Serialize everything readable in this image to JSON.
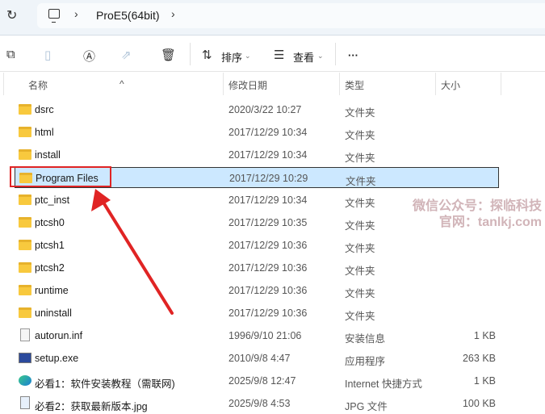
{
  "address": {
    "crumbs": [
      "ProE5(64bit)"
    ]
  },
  "toolbar": {
    "sort_label": "排序",
    "view_label": "查看",
    "more_label": "···"
  },
  "columns": {
    "name": "名称",
    "date": "修改日期",
    "type": "类型",
    "size": "大小"
  },
  "rows": [
    {
      "name": "dsrc",
      "date": "2020/3/22 10:27",
      "type": "文件夹",
      "size": "",
      "icon": "folder"
    },
    {
      "name": "html",
      "date": "2017/12/29 10:34",
      "type": "文件夹",
      "size": "",
      "icon": "folder"
    },
    {
      "name": "install",
      "date": "2017/12/29 10:34",
      "type": "文件夹",
      "size": "",
      "icon": "folder"
    },
    {
      "name": "Program Files",
      "date": "2017/12/29 10:29",
      "type": "文件夹",
      "size": "",
      "icon": "folder",
      "selected": true
    },
    {
      "name": "ptc_inst",
      "date": "2017/12/29 10:34",
      "type": "文件夹",
      "size": "",
      "icon": "folder"
    },
    {
      "name": "ptcsh0",
      "date": "2017/12/29 10:35",
      "type": "文件夹",
      "size": "",
      "icon": "folder"
    },
    {
      "name": "ptcsh1",
      "date": "2017/12/29 10:36",
      "type": "文件夹",
      "size": "",
      "icon": "folder"
    },
    {
      "name": "ptcsh2",
      "date": "2017/12/29 10:36",
      "type": "文件夹",
      "size": "",
      "icon": "folder"
    },
    {
      "name": "runtime",
      "date": "2017/12/29 10:36",
      "type": "文件夹",
      "size": "",
      "icon": "folder"
    },
    {
      "name": "uninstall",
      "date": "2017/12/29 10:36",
      "type": "文件夹",
      "size": "",
      "icon": "folder"
    },
    {
      "name": "autorun.inf",
      "date": "1996/9/10 21:06",
      "type": "安装信息",
      "size": "1 KB",
      "icon": "file"
    },
    {
      "name": "setup.exe",
      "date": "2010/9/8 4:47",
      "type": "应用程序",
      "size": "263 KB",
      "icon": "exe"
    },
    {
      "name": "必看1：软件安装教程（需联网)",
      "date": "2025/9/8 12:47",
      "type": "Internet 快捷方式",
      "size": "1 KB",
      "icon": "edge"
    },
    {
      "name": "必看2：获取最新版本.jpg",
      "date": "2025/9/8 4:53",
      "type": "JPG 文件",
      "size": "100 KB",
      "icon": "jpg"
    }
  ],
  "watermark": {
    "line1": "微信公众号：探临科技",
    "line2": "官网：tanlkj.com"
  },
  "colors": {
    "selection": "#cce8ff",
    "highlight": "#e02424"
  }
}
